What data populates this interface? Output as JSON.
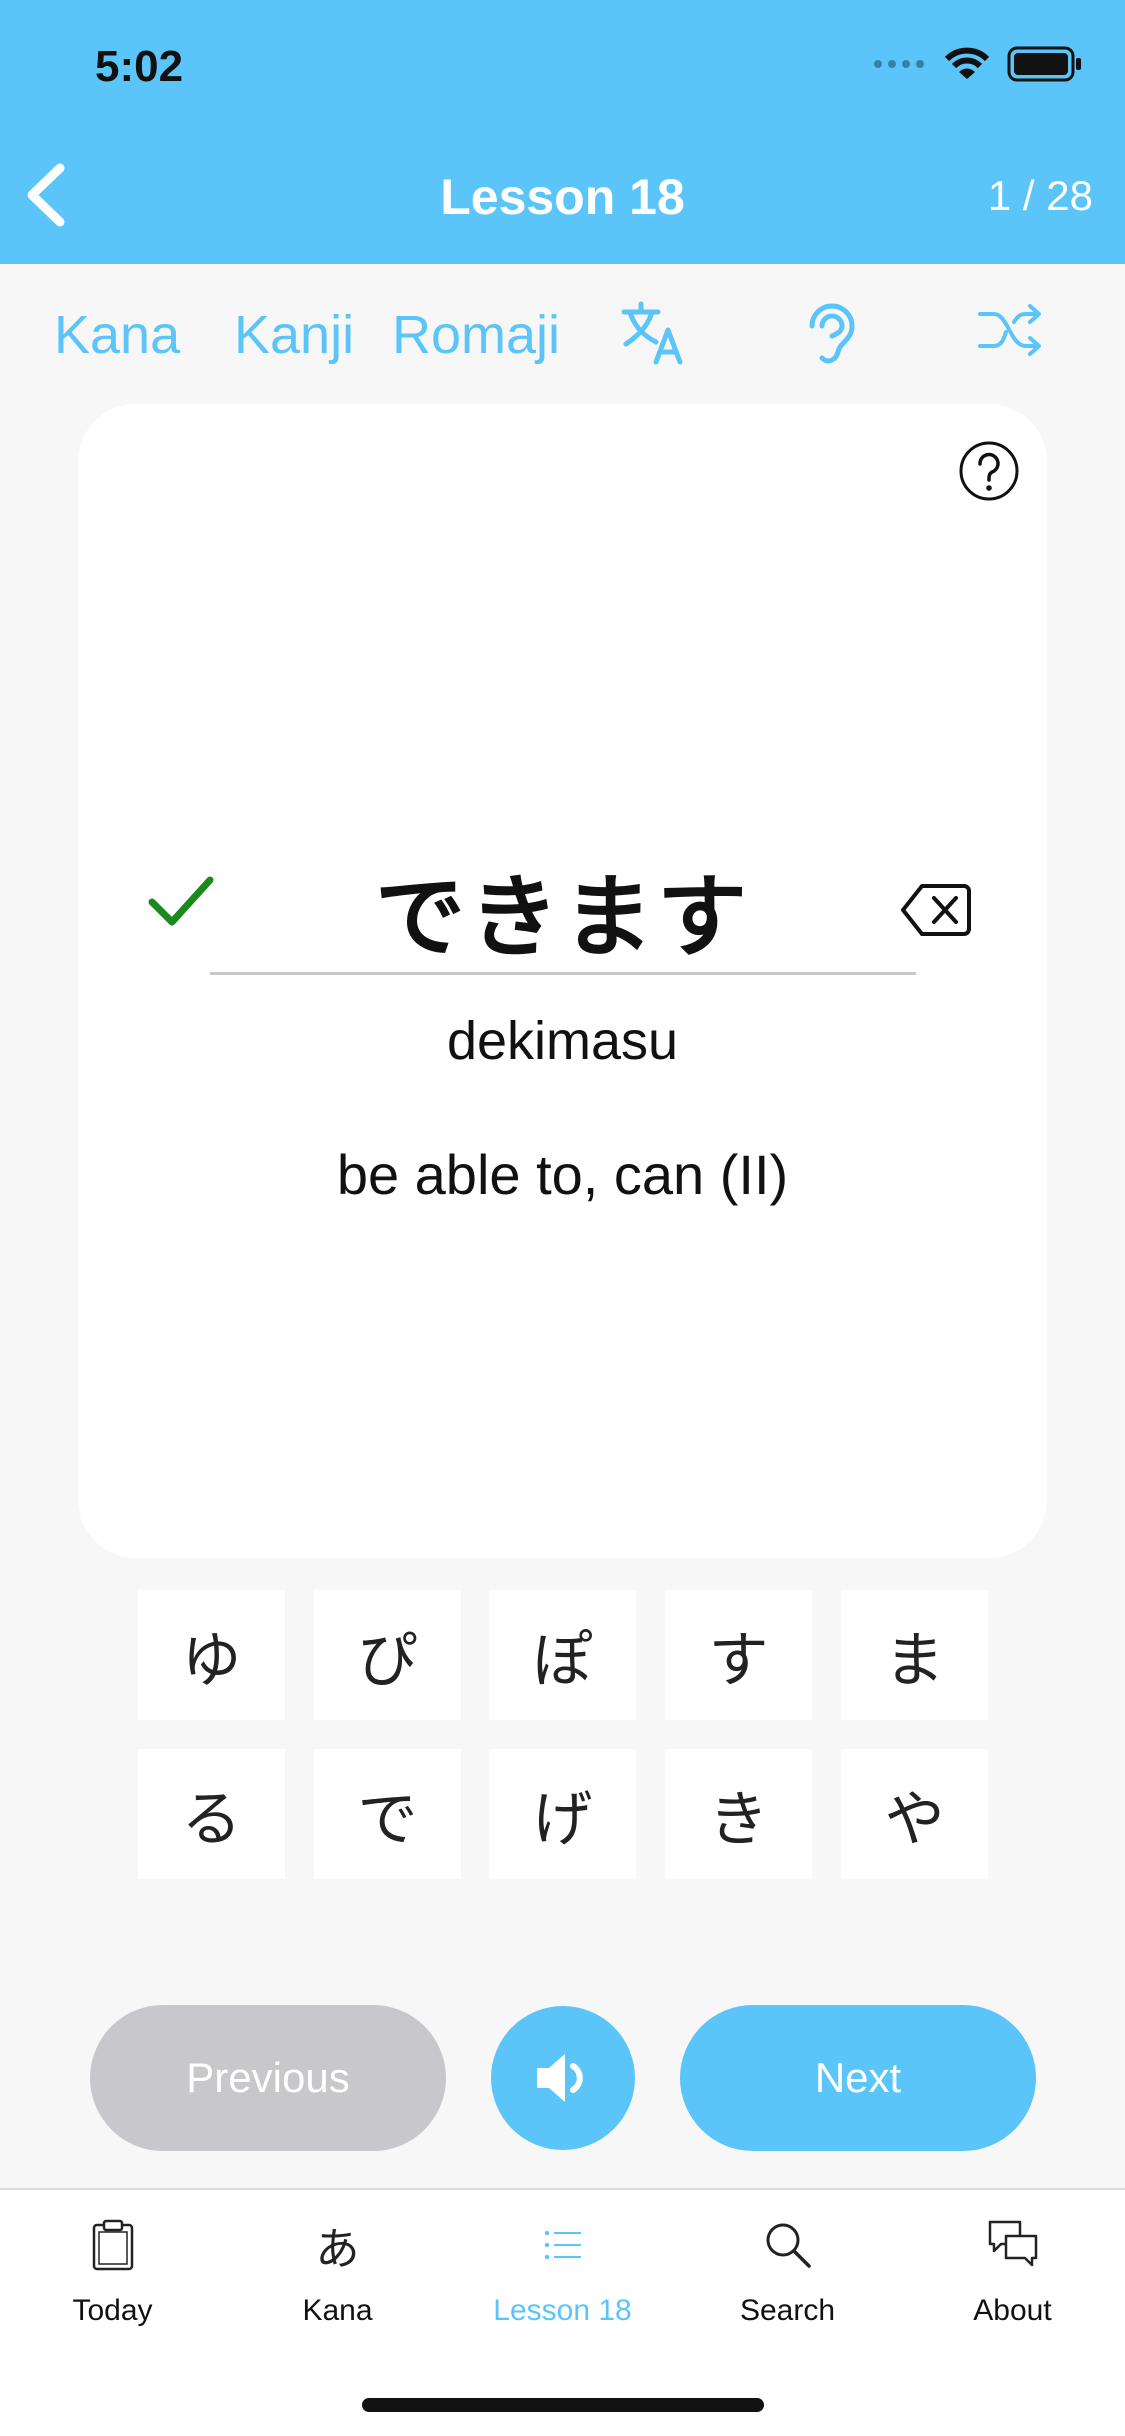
{
  "status_bar": {
    "time": "5:02"
  },
  "nav": {
    "title": "Lesson 18",
    "counter": "1 / 28"
  },
  "modes": {
    "kana": "Kana",
    "kanji": "Kanji",
    "romaji": "Romaji"
  },
  "card": {
    "answer": "できます",
    "romaji": "dekimasu",
    "meaning": "be able to, can (II)"
  },
  "keys": [
    "ゆ",
    "ぴ",
    "ぽ",
    "す",
    "ま",
    "る",
    "で",
    "げ",
    "き",
    "や"
  ],
  "buttons": {
    "previous": "Previous",
    "next": "Next"
  },
  "tabs": [
    {
      "label": "Today",
      "icon": "clipboard-icon"
    },
    {
      "label": "Kana",
      "icon": "hiragana-a-icon",
      "glyph": "あ"
    },
    {
      "label": "Lesson 18",
      "icon": "list-icon"
    },
    {
      "label": "Search",
      "icon": "search-icon"
    },
    {
      "label": "About",
      "icon": "chat-bubbles-icon"
    }
  ],
  "colors": {
    "accent": "#5bc5f9",
    "disabled": "#c7c7cc",
    "success": "#1a8a1a"
  }
}
